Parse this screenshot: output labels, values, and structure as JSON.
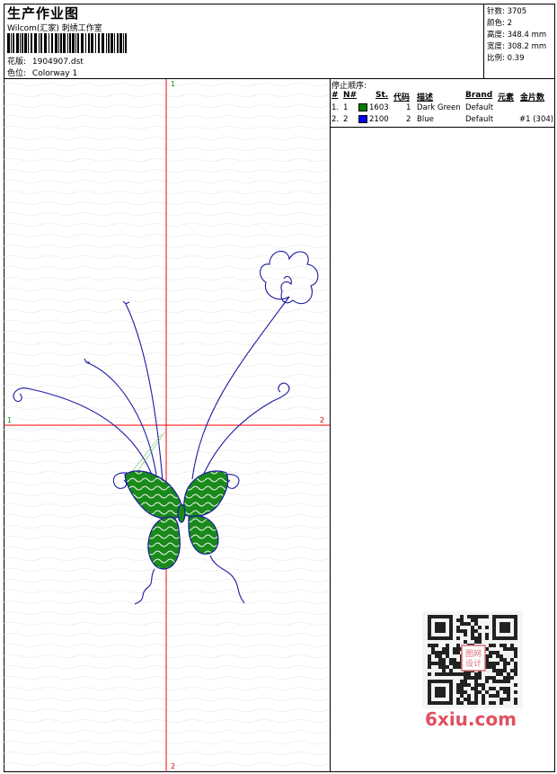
{
  "header": {
    "title": "生产作业图",
    "subtitle": "Wilcom(汇家) 刺绣工作室",
    "design_label": "花版:",
    "design_value": "1904907.dst",
    "colorway_label": "色位:",
    "colorway_value": "Colorway 1"
  },
  "stats": {
    "stitches": "针数: 3705",
    "colors": "颜色: 2",
    "height": "高度: 348.4 mm",
    "width": "宽度: 308.2 mm",
    "scale": "比例: 0.39"
  },
  "canvas": {
    "marker_top": "1",
    "marker_bottom": "2",
    "marker_left": "1",
    "marker_right": "2",
    "axis_color": "#ff0000",
    "stitch_green": "#1a8a1a",
    "stitch_blue": "#1a1aa0"
  },
  "stop_sequence": {
    "title": "停止顺序:",
    "headers": [
      "#",
      "N#",
      "St.",
      "代码",
      "描述",
      "Brand",
      "元素",
      "金片数"
    ],
    "rows": [
      {
        "num": "1.",
        "n": "1",
        "color": "#008000",
        "st": "1603",
        "code": "1",
        "desc": "Dark Green",
        "brand": "Default",
        "element": "",
        "sequin": ""
      },
      {
        "num": "2.",
        "n": "2",
        "color": "#0000ff",
        "st": "2100",
        "code": "2",
        "desc": "Blue",
        "brand": "Default",
        "element": "",
        "sequin": "#1 (304)"
      }
    ]
  },
  "watermark": {
    "text": "6xiu.com",
    "stamp": "图网\n设计"
  }
}
